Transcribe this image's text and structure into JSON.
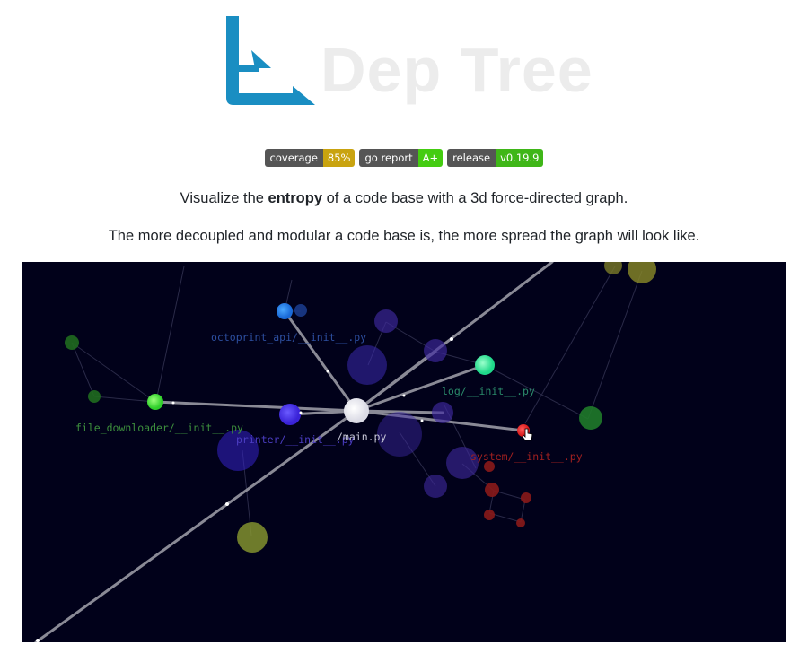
{
  "logo": {
    "text": "Dep Tree",
    "mark_color": "#1a8ec2",
    "text_color": "#ececec"
  },
  "badges": [
    {
      "label": "coverage",
      "value": "85%",
      "color": "#c9a30f"
    },
    {
      "label": "go report",
      "value": "A+",
      "color": "#44cc11"
    },
    {
      "label": "release",
      "value": "v0.19.9",
      "color": "#3fb618"
    }
  ],
  "description": {
    "line1_before": "Visualize the ",
    "line1_bold": "entropy",
    "line1_after": " of a code base with a 3d force-directed graph.",
    "line2": "The more decoupled and modular a code base is, the more spread the graph will look like."
  },
  "graph": {
    "background": "#01011a",
    "labels": {
      "octoprint": "octoprint_api/__init__.py",
      "log": "log/__init__.py",
      "file_downloader": "file_downloader/__init__.py",
      "printer": "printer/__init__.py",
      "main": "/main.py",
      "system": "system/__init__.py"
    },
    "label_colors": {
      "octoprint": "#2d4fa0",
      "log": "#2a8a6a",
      "file_downloader": "#3d8f3d",
      "printer": "#4b3dc2",
      "main": "#c8c8d8",
      "system": "#a02020"
    }
  }
}
